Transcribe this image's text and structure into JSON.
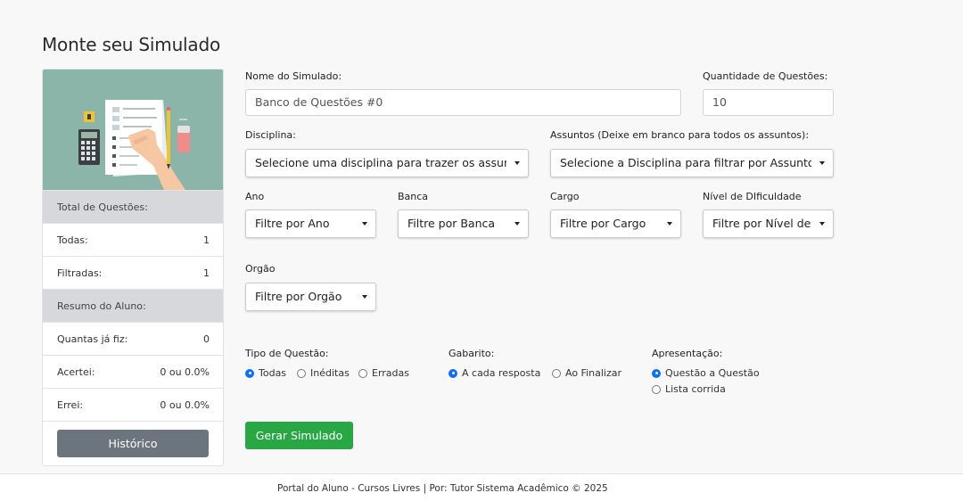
{
  "page": {
    "title": "Monte seu Simulado"
  },
  "summary": {
    "total_header": "Total de Questões:",
    "todas_label": "Todas:",
    "todas_value": "1",
    "filtradas_label": "Filtradas:",
    "filtradas_value": "1",
    "aluno_header": "Resumo do Aluno:",
    "quantas_label": "Quantas já fiz:",
    "quantas_value": "0",
    "acertei_label": "Acertei:",
    "acertei_value": "0 ou 0.0%",
    "errei_label": "Errei:",
    "errei_value": "0 ou 0.0%",
    "historico_button": "Histórico"
  },
  "form": {
    "nome_label": "Nome do Simulado:",
    "nome_value": "Banco de Questões #0",
    "quantidade_label": "Quantidade de Questões:",
    "quantidade_value": "10",
    "disciplina_label": "Disciplina:",
    "disciplina_value": "Selecione uma disciplina para trazer os assuntos",
    "assuntos_label": "Assuntos (Deixe em branco para todos os assuntos):",
    "assuntos_value": "Selecione a Disciplina para filtrar por Assuntos",
    "ano_label": "Ano",
    "ano_value": "Filtre por Ano",
    "banca_label": "Banca",
    "banca_value": "Filtre por Banca",
    "cargo_label": "Cargo",
    "cargo_value": "Filtre por Cargo",
    "nivel_label": "Nível de DIficuldade",
    "nivel_value": "Filtre por Nível de Dificuldade",
    "orgao_label": "Orgão",
    "orgao_value": "Filtre por Orgão",
    "tipo_label": "Tipo de Questão:",
    "tipo_options": [
      "Todas",
      "Inéditas",
      "Erradas"
    ],
    "tipo_selected": "Todas",
    "gabarito_label": "Gabarito:",
    "gabarito_options": [
      "A cada resposta",
      "Ao Finalizar"
    ],
    "gabarito_selected": "A cada resposta",
    "apresentacao_label": "Apresentação:",
    "apresentacao_options": [
      "Questão a Questão",
      "Lista corrida"
    ],
    "apresentacao_selected": "Questão a Questão",
    "gerar_button": "Gerar Simulado"
  },
  "footer": {
    "text": "Portal do Aluno - Cursos Livres | Por: Tutor Sistema Acadêmico © 2025"
  },
  "colors": {
    "primary": "#0d6efd",
    "success": "#28a745",
    "secondary": "#6c757d",
    "illustration_bg": "#8bb5a8"
  }
}
